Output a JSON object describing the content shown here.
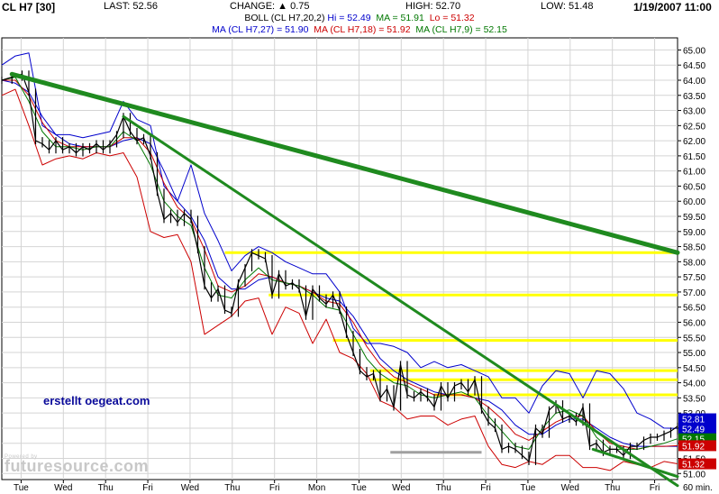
{
  "header": {
    "title": "CL H7 [30]",
    "last": "LAST: 52.56",
    "change": "CHANGE: ▲ 0.75",
    "high": "HIGH: 52.70",
    "low": "LOW: 51.48",
    "date": "1/19/2007 11:00"
  },
  "indicators": {
    "boll": {
      "prefix": "BOLL (CL H7,20,2) ",
      "hi": "Hi = 52.49",
      "ma": "MA = 51.91",
      "lo": "Lo = 51.32"
    },
    "ma27": "MA (CL H7,27) = 51.90",
    "ma18": "MA (CL H7,18) = 51.92",
    "ma9": "MA (CL H7,9) = 52.15"
  },
  "watermark": {
    "top": "Powered by",
    "brand": "futuresource.com"
  },
  "annotation": "erstellt oegeat.com",
  "colors": {
    "price": "#000000",
    "boll_hi": "#0000cc",
    "boll_lo": "#cc0000",
    "ma27": "#0000cc",
    "ma18": "#cc0000",
    "ma9": "#007700",
    "trendline": "#1f8a1f",
    "resistance": "#ffff00",
    "support": "#a0a0a0",
    "grid": "#d4d4d4"
  },
  "chart_data": {
    "type": "line",
    "symbol": "CL H7",
    "interval": "30",
    "x_unit": "60 min.",
    "categories": [
      "Tue",
      "Wed",
      "Thu",
      "Fri",
      "Wed",
      "Thu",
      "Fri",
      "Mon",
      "Tue",
      "Wed",
      "Thu",
      "Fri",
      "Tue",
      "Wed",
      "Thu",
      "Fri"
    ],
    "y_ticks": [
      "65.00",
      "64.50",
      "64.00",
      "63.50",
      "63.00",
      "62.50",
      "62.00",
      "61.50",
      "61.00",
      "60.50",
      "60.00",
      "59.50",
      "59.00",
      "58.50",
      "58.00",
      "57.50",
      "57.00",
      "56.50",
      "56.00",
      "55.50",
      "55.00",
      "54.50",
      "54.00",
      "53.50",
      "53.00",
      "52.50",
      "52.00",
      "51.50",
      "51.00"
    ],
    "ylim": [
      50.8,
      65.4
    ],
    "grid": true,
    "price_series": {
      "x": [
        0,
        3,
        6,
        8,
        10,
        12,
        14,
        16,
        18,
        20,
        22,
        24,
        26,
        28,
        30,
        32,
        34,
        36,
        38,
        40,
        42,
        44,
        46,
        48,
        50,
        52,
        54,
        56,
        58,
        60,
        62,
        64,
        66,
        68,
        70,
        72,
        74,
        76,
        78,
        80,
        82,
        84,
        86,
        88,
        90,
        92,
        94,
        96,
        98,
        100,
        102,
        104,
        106,
        108,
        110,
        112,
        114,
        116,
        118,
        120,
        122,
        124,
        126,
        128,
        130,
        132,
        134,
        136,
        138,
        140,
        142,
        144,
        146,
        148,
        150,
        152,
        154,
        156,
        158,
        160,
        162,
        164,
        166,
        168,
        170,
        172,
        174,
        176,
        178,
        180,
        182,
        184,
        186,
        188,
        190,
        192,
        194,
        196,
        198,
        200
      ],
      "values": [
        64.0,
        64.1,
        64.2,
        63.6,
        62.0,
        61.9,
        61.7,
        62.0,
        61.7,
        61.8,
        61.6,
        61.8,
        61.7,
        61.9,
        61.7,
        61.9,
        62.2,
        62.8,
        62.3,
        62.0,
        62.1,
        61.5,
        60.3,
        59.4,
        59.6,
        59.3,
        59.6,
        59.4,
        58.4,
        57.2,
        56.8,
        57.1,
        56.4,
        56.3,
        57.3,
        57.8,
        58.3,
        58.2,
        58.1,
        56.9,
        57.6,
        57.2,
        57.3,
        57.1,
        56.2,
        57.1,
        56.8,
        56.6,
        56.9,
        56.4,
        55.6,
        55.0,
        54.4,
        54.2,
        54.3,
        53.5,
        53.8,
        53.2,
        54.6,
        53.6,
        53.5,
        53.7,
        53.5,
        53.2,
        53.9,
        53.5,
        53.9,
        54.0,
        53.7,
        54.1,
        53.1,
        52.7,
        52.5,
        51.8,
        51.9,
        51.8,
        51.6,
        51.4,
        52.5,
        52.3,
        53.1,
        53.3,
        52.8,
        52.9,
        52.7,
        53.2,
        51.9,
        52.0,
        51.7,
        51.8,
        51.8,
        51.6,
        51.9,
        51.9,
        52.1,
        52.2,
        52.2,
        52.3,
        52.4,
        52.56
      ]
    },
    "boll_hi": {
      "name": "BOLL Hi",
      "x": [
        0,
        4,
        8,
        12,
        16,
        20,
        24,
        28,
        32,
        36,
        40,
        44,
        48,
        52,
        56,
        60,
        64,
        68,
        72,
        76,
        80,
        84,
        88,
        92,
        96,
        100,
        104,
        108,
        112,
        116,
        120,
        124,
        128,
        132,
        136,
        140,
        144,
        148,
        152,
        156,
        160,
        164,
        168,
        172,
        176,
        180,
        184,
        188,
        192,
        196,
        200
      ],
      "values": [
        64.5,
        64.8,
        64.9,
        62.5,
        62.2,
        62.2,
        62.1,
        62.2,
        62.3,
        63.3,
        62.7,
        62.5,
        60.5,
        60.0,
        61.2,
        59.6,
        58.7,
        57.7,
        58.2,
        58.5,
        58.3,
        58.0,
        57.8,
        57.6,
        57.6,
        57.0,
        55.8,
        55.3,
        55.3,
        55.2,
        55.0,
        54.5,
        54.7,
        54.5,
        54.6,
        54.4,
        54.2,
        53.5,
        53.5,
        53.0,
        53.9,
        54.4,
        54.3,
        53.5,
        54.4,
        54.3,
        53.8,
        53.0,
        52.8,
        52.5,
        52.49
      ]
    },
    "boll_lo": {
      "name": "BOLL Lo",
      "x": [
        0,
        4,
        8,
        12,
        16,
        20,
        24,
        28,
        32,
        36,
        40,
        44,
        48,
        52,
        56,
        60,
        64,
        68,
        72,
        76,
        80,
        84,
        88,
        92,
        96,
        100,
        104,
        108,
        112,
        116,
        120,
        124,
        128,
        132,
        136,
        140,
        144,
        148,
        152,
        156,
        160,
        164,
        168,
        172,
        176,
        180,
        184,
        188,
        192,
        196,
        200
      ],
      "values": [
        63.5,
        63.7,
        62.5,
        61.2,
        61.4,
        61.5,
        61.4,
        61.6,
        61.5,
        61.6,
        60.8,
        59.0,
        58.8,
        58.9,
        58.0,
        55.6,
        55.9,
        56.2,
        56.7,
        56.8,
        55.6,
        56.5,
        56.3,
        55.3,
        56.1,
        55.0,
        54.8,
        54.3,
        53.4,
        53.2,
        52.8,
        52.9,
        52.9,
        52.6,
        52.8,
        52.9,
        51.9,
        51.3,
        51.2,
        51.4,
        51.3,
        51.6,
        51.6,
        51.2,
        51.2,
        51.1,
        51.4,
        51.3,
        51.2,
        51.4,
        51.32
      ]
    },
    "ma_series": [
      {
        "name": "MA (CL H7,27)",
        "values": [
          64.0,
          63.9,
          63.6,
          62.8,
          62.2,
          61.9,
          61.8,
          61.8,
          61.8,
          62.0,
          62.1,
          61.9,
          61.0,
          60.0,
          59.5,
          58.7,
          57.5,
          57.1,
          57.1,
          57.4,
          57.5,
          57.3,
          57.2,
          57.0,
          56.8,
          56.7,
          56.2,
          55.5,
          54.8,
          54.4,
          54.1,
          53.9,
          53.7,
          53.6,
          53.6,
          53.5,
          53.4,
          53.1,
          52.6,
          52.3,
          52.3,
          52.6,
          52.8,
          52.8,
          52.5,
          52.2,
          52.0,
          51.9,
          51.9,
          51.9,
          51.9
        ]
      },
      {
        "name": "MA (CL H7,18)",
        "values": [
          64.0,
          64.0,
          63.5,
          62.6,
          62.0,
          61.8,
          61.8,
          61.8,
          61.8,
          62.1,
          62.1,
          61.6,
          60.6,
          59.8,
          59.4,
          58.4,
          57.2,
          57.0,
          57.2,
          57.6,
          57.5,
          57.3,
          57.2,
          57.0,
          56.7,
          56.6,
          56.0,
          55.2,
          54.6,
          54.2,
          54.0,
          53.8,
          53.6,
          53.6,
          53.6,
          53.5,
          53.2,
          52.8,
          52.3,
          52.1,
          52.4,
          52.7,
          52.9,
          52.9,
          52.4,
          52.0,
          51.9,
          51.8,
          51.9,
          51.9,
          51.92
        ]
      },
      {
        "name": "MA (CL H7,9)",
        "values": [
          64.0,
          64.1,
          63.3,
          62.3,
          61.8,
          61.8,
          61.7,
          61.8,
          61.8,
          62.3,
          62.0,
          61.2,
          60.0,
          59.5,
          59.2,
          57.8,
          56.9,
          56.8,
          57.4,
          57.8,
          57.4,
          57.3,
          57.2,
          56.9,
          56.5,
          56.4,
          55.6,
          54.8,
          54.3,
          54.0,
          53.9,
          53.6,
          53.5,
          53.6,
          53.7,
          53.5,
          52.9,
          52.4,
          51.9,
          51.8,
          52.5,
          53.0,
          53.1,
          52.9,
          52.2,
          51.8,
          51.8,
          51.8,
          51.9,
          52.0,
          52.15
        ]
      }
    ],
    "trendlines": [
      {
        "from": [
          3,
          64.2
        ],
        "to": [
          200,
          58.3
        ]
      },
      {
        "from": [
          36,
          62.8
        ],
        "to": [
          200,
          50.6
        ]
      },
      {
        "from": [
          175,
          51.8
        ],
        "to": [
          200,
          50.9
        ]
      }
    ],
    "resistance_levels": [
      {
        "value": 58.3,
        "x_from": 66,
        "x_to": 200
      },
      {
        "value": 56.9,
        "x_from": 79,
        "x_to": 200
      },
      {
        "value": 55.4,
        "x_from": 98,
        "x_to": 200
      },
      {
        "value": 54.4,
        "x_from": 109,
        "x_to": 200
      },
      {
        "value": 54.1,
        "x_from": 109,
        "x_to": 200
      },
      {
        "value": 53.6,
        "x_from": 128,
        "x_to": 200
      }
    ],
    "support_levels": [
      {
        "value": 51.7,
        "x_from": 115,
        "x_to": 142
      }
    ],
    "value_boxes": [
      {
        "label": "52.81",
        "value": 52.81,
        "color": "#0000cc"
      },
      {
        "label": "52.49",
        "value": 52.49,
        "color": "#0000cc"
      },
      {
        "label": "52.15",
        "value": 52.15,
        "color": "#007700"
      },
      {
        "label": "51.92",
        "value": 51.92,
        "color": "#cc0000"
      },
      {
        "label": "51.32",
        "value": 51.32,
        "color": "#cc0000"
      }
    ]
  }
}
